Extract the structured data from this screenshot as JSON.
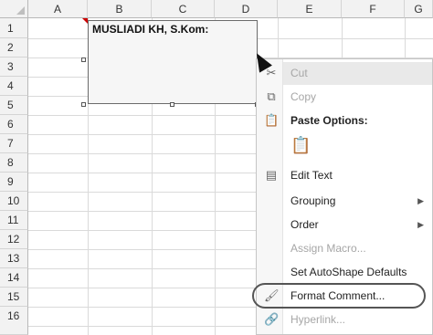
{
  "columns": [
    "A",
    "B",
    "C",
    "D",
    "E",
    "F",
    "G"
  ],
  "rows": [
    "1",
    "2",
    "3",
    "4",
    "5",
    "6",
    "7",
    "8",
    "9",
    "10",
    "11",
    "12",
    "13",
    "14",
    "15",
    "16"
  ],
  "comment": {
    "text": "MUSLIADI KH, S.Kom:"
  },
  "menu": {
    "cut": "Cut",
    "copy": "Copy",
    "paste_options": "Paste Options:",
    "edit_text": "Edit Text",
    "grouping": "Grouping",
    "order": "Order",
    "assign_macro": "Assign Macro...",
    "set_autoshape_defaults": "Set AutoShape Defaults",
    "format_comment": "Format Comment...",
    "hyperlink": "Hyperlink..."
  }
}
